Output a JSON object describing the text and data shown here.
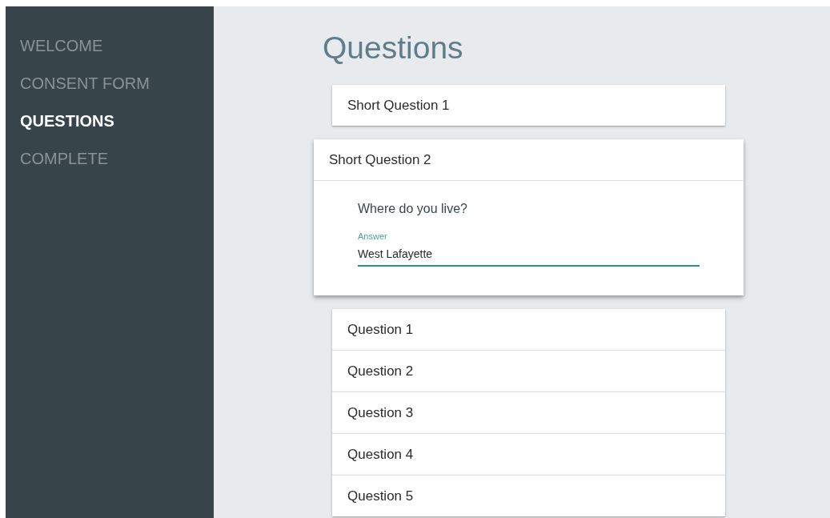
{
  "sidebar": {
    "items": [
      {
        "label": "WELCOME",
        "selected": false
      },
      {
        "label": "CONSENT FORM",
        "selected": false
      },
      {
        "label": "QUESTIONS",
        "selected": true
      },
      {
        "label": "COMPLETE",
        "selected": false
      }
    ]
  },
  "page_title": "Questions",
  "panels": [
    {
      "title": "Short Question 1",
      "expanded": false
    },
    {
      "title": "Short Question 2",
      "expanded": true,
      "question": "Where do you live?",
      "field": {
        "label": "Answer",
        "value": "West Lafayette"
      }
    },
    {
      "title": "Question 1",
      "expanded": false
    },
    {
      "title": "Question 2",
      "expanded": false
    },
    {
      "title": "Question 3",
      "expanded": false
    },
    {
      "title": "Question 4",
      "expanded": false
    },
    {
      "title": "Question 5",
      "expanded": false
    }
  ]
}
